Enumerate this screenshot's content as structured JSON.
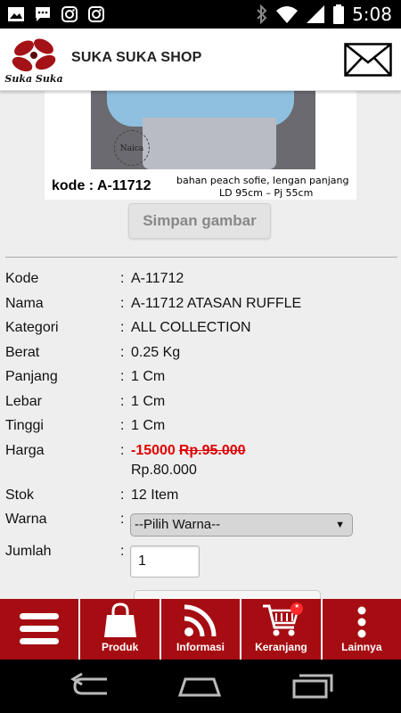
{
  "status_bar": {
    "time": "5:08",
    "left_icons": [
      "image-icon",
      "chat-icon",
      "instagram-icon",
      "instagram-icon"
    ],
    "right_icons": [
      "bluetooth-icon",
      "wifi-icon",
      "signal-icon",
      "battery-icon"
    ]
  },
  "header": {
    "logo_text": "Suka Suka",
    "title": "SUKA SUKA SHOP"
  },
  "product_image": {
    "stamp_text": "Naica",
    "code_text": "kode : A-11712",
    "caption_line1": "bahan peach sofie, lengan panjang",
    "caption_line2": "LD 95cm – Pj 55cm"
  },
  "save_button": "Simpan gambar",
  "details": {
    "colon": ":",
    "kode": {
      "label": "Kode",
      "value": "A-11712"
    },
    "nama": {
      "label": "Nama",
      "value": "A-11712 ATASAN RUFFLE"
    },
    "kategori": {
      "label": "Kategori",
      "value": "ALL COLLECTION"
    },
    "berat": {
      "label": "Berat",
      "value": "0.25 Kg"
    },
    "panjang": {
      "label": "Panjang",
      "value": "1 Cm"
    },
    "lebar": {
      "label": "Lebar",
      "value": "1 Cm"
    },
    "tinggi": {
      "label": "Tinggi",
      "value": "1 Cm"
    },
    "harga": {
      "label": "Harga",
      "discount": "-15000",
      "old_price": "Rp.95.000",
      "new_price": "Rp.80.000"
    },
    "stok": {
      "label": "Stok",
      "value": "12 Item"
    },
    "warna": {
      "label": "Warna",
      "selected": "--Pilih Warna--"
    },
    "jumlah": {
      "label": "Jumlah",
      "value": "1"
    }
  },
  "bottom_nav": [
    {
      "label": "",
      "icon": "menu-icon"
    },
    {
      "label": "Produk",
      "icon": "bag-icon"
    },
    {
      "label": "Informasi",
      "icon": "rss-icon"
    },
    {
      "label": "Keranjang",
      "icon": "cart-icon",
      "badge": "*"
    },
    {
      "label": "Lainnya",
      "icon": "more-icon"
    }
  ],
  "colors": {
    "nav_red": "#a50d12",
    "price_red": "#e00000",
    "content_bg": "#eeeeee"
  }
}
